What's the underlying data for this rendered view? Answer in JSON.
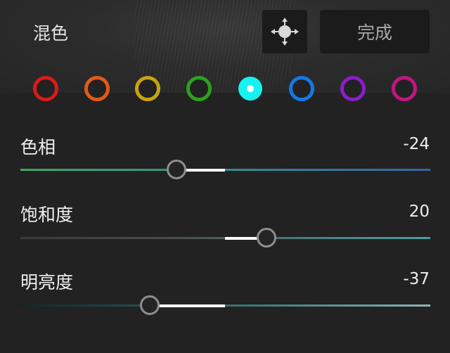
{
  "header": {
    "title": "混色",
    "move_icon": "move-arrows-icon",
    "done_label": "完成"
  },
  "swatches": [
    {
      "name": "red",
      "color": "#d81b1b",
      "selected": false
    },
    {
      "name": "orange",
      "color": "#e05a16",
      "selected": false
    },
    {
      "name": "yellow",
      "color": "#c8a40e",
      "selected": false
    },
    {
      "name": "green",
      "color": "#2ca01e",
      "selected": false
    },
    {
      "name": "aqua",
      "color": "#15f2f2",
      "selected": true
    },
    {
      "name": "blue",
      "color": "#1478e6",
      "selected": false
    },
    {
      "name": "purple",
      "color": "#8a1ec8",
      "selected": false
    },
    {
      "name": "magenta",
      "color": "#c01680",
      "selected": false
    }
  ],
  "sliders": {
    "hue": {
      "label": "色相",
      "value": "-24",
      "num": -24,
      "min": -100,
      "max": 100
    },
    "saturation": {
      "label": "饱和度",
      "value": "20",
      "num": 20,
      "min": -100,
      "max": 100
    },
    "luminance": {
      "label": "明亮度",
      "value": "-37",
      "num": -37,
      "min": -100,
      "max": 100
    }
  }
}
